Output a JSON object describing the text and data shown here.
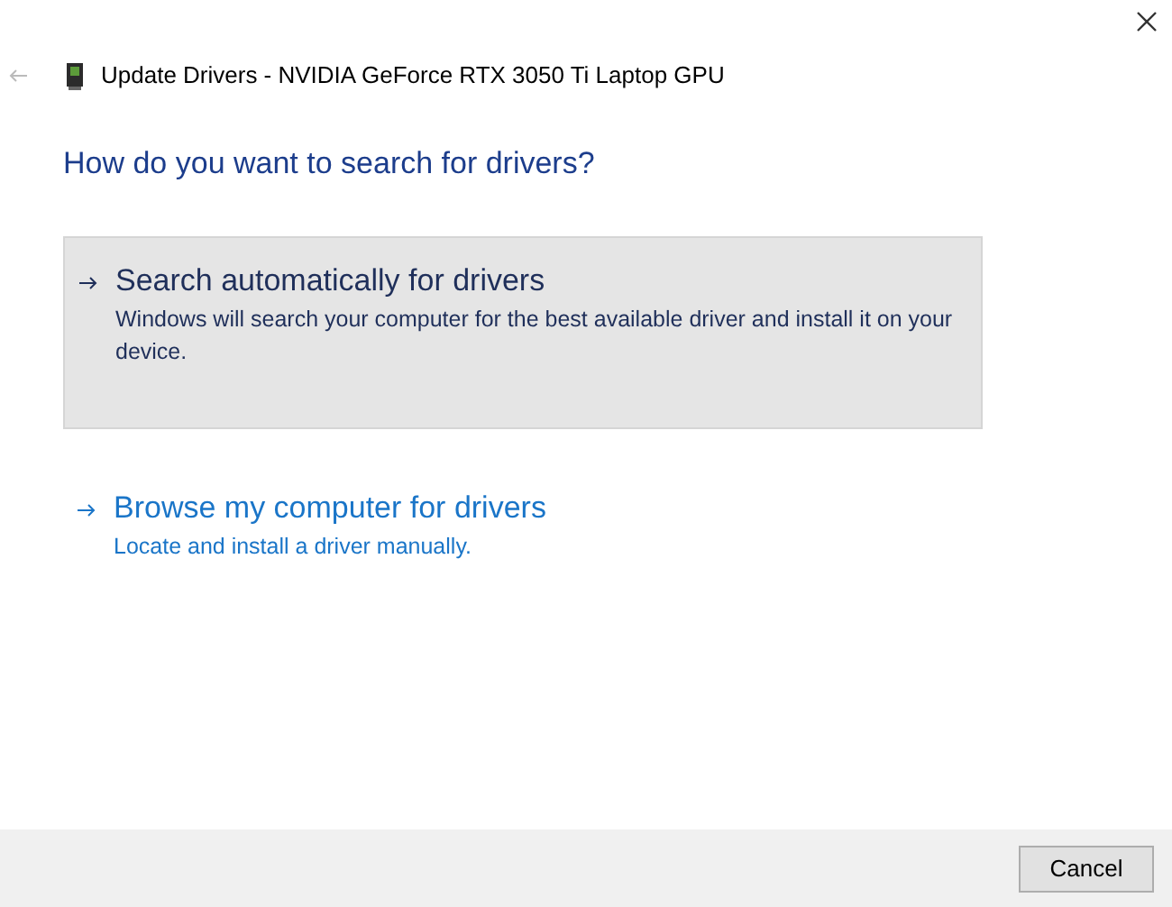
{
  "window": {
    "title": "Update Drivers - NVIDIA GeForce RTX 3050 Ti Laptop GPU"
  },
  "heading": "How do you want to search for drivers?",
  "options": [
    {
      "title": "Search automatically for drivers",
      "description": "Windows will search your computer for the best available driver and install it on your device.",
      "highlighted": true
    },
    {
      "title": "Browse my computer for drivers",
      "description": "Locate and install a driver manually.",
      "highlighted": false
    }
  ],
  "buttons": [
    "Cancel"
  ]
}
